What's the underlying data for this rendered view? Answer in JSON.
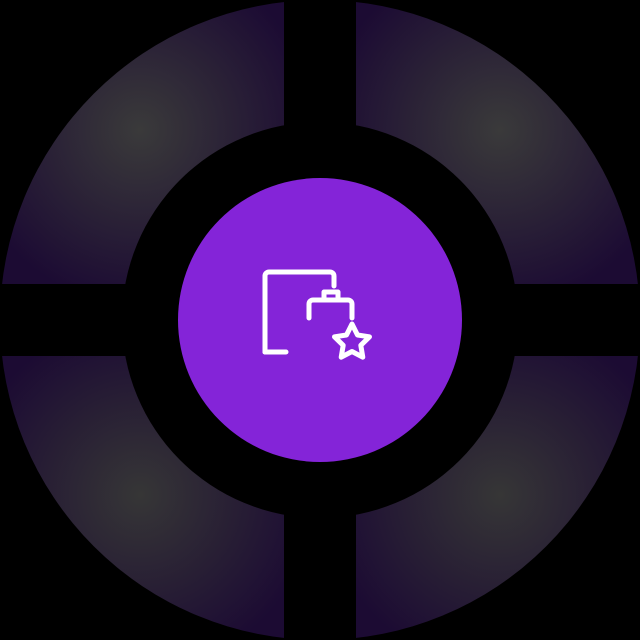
{
  "colors": {
    "background": "#000000",
    "ring_dark": "#1c0b33",
    "ring_glow": "#3a3a3a",
    "badge": "#8424d8",
    "icon_stroke": "#ffffff"
  },
  "badge": {
    "icon": "folder-star-icon"
  }
}
